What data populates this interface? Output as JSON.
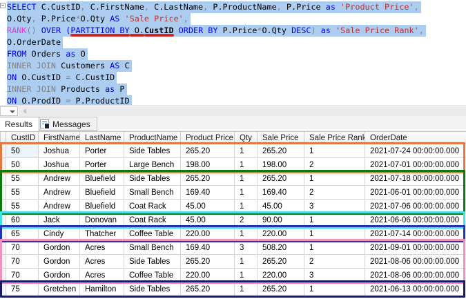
{
  "colors": {
    "sel": "#adcdf0",
    "kw": "#0000ee",
    "gray": "#838383",
    "ink": "#000000",
    "str": "#bf2e2e",
    "fn": "#dd3cdd",
    "underline": "#d32525",
    "gridline": "#d4d4d4",
    "headerline": "#c9c9c9"
  },
  "editor": {
    "lines": [
      {
        "tokens": [
          {
            "c": "k",
            "t": "SELECT"
          },
          {
            "c": "i",
            "t": " C.CustID"
          },
          {
            "c": "g",
            "t": ","
          },
          {
            "c": "i",
            "t": " C.FirstName"
          },
          {
            "c": "g",
            "t": ","
          },
          {
            "c": "i",
            "t": " C.LastName"
          },
          {
            "c": "g",
            "t": ","
          },
          {
            "c": "i",
            "t": " P.ProductName"
          },
          {
            "c": "g",
            "t": ","
          },
          {
            "c": "i",
            "t": " P.Price "
          },
          {
            "c": "k",
            "t": "as"
          },
          {
            "c": "s",
            "t": " 'Product Price'"
          },
          {
            "c": "g",
            "t": ","
          }
        ]
      },
      {
        "tokens": [
          {
            "c": "i",
            "t": "O.Qty"
          },
          {
            "c": "g",
            "t": ","
          },
          {
            "c": "i",
            "t": " P.Price"
          },
          {
            "c": "g",
            "t": "*"
          },
          {
            "c": "i",
            "t": "O.Qty "
          },
          {
            "c": "k",
            "t": "AS"
          },
          {
            "c": "s",
            "t": " 'Sale Price'"
          },
          {
            "c": "g",
            "t": ","
          }
        ]
      },
      {
        "tokens": [
          {
            "c": "f",
            "t": "RANK"
          },
          {
            "c": "g",
            "t": "()"
          },
          {
            "c": "i",
            "t": " "
          },
          {
            "c": "k",
            "t": "OVER"
          },
          {
            "c": "i",
            "t": " "
          },
          {
            "c": "k",
            "t": "("
          },
          {
            "c": "k",
            "t": "PARTITION BY",
            "u": true
          },
          {
            "c": "i",
            "t": " O.",
            "u": true
          },
          {
            "c": "b",
            "t": "CustID",
            "u": true
          },
          {
            "c": "i",
            "t": " "
          },
          {
            "c": "k",
            "t": "ORDER BY"
          },
          {
            "c": "i",
            "t": " P.Price"
          },
          {
            "c": "g",
            "t": "*"
          },
          {
            "c": "i",
            "t": "O.Qty "
          },
          {
            "c": "k",
            "t": "DESC"
          },
          {
            "c": "g",
            "t": ")"
          },
          {
            "c": "i",
            "t": " "
          },
          {
            "c": "k",
            "t": "as"
          },
          {
            "c": "s",
            "t": " 'Sale Price Rank'"
          },
          {
            "c": "g",
            "t": ","
          }
        ]
      },
      {
        "tokens": [
          {
            "c": "i",
            "t": "O.OrderDate"
          }
        ]
      },
      {
        "tokens": [
          {
            "c": "k",
            "t": "FROM"
          },
          {
            "c": "i",
            "t": " Orders "
          },
          {
            "c": "k",
            "t": "as"
          },
          {
            "c": "i",
            "t": " O"
          }
        ]
      },
      {
        "tokens": [
          {
            "c": "g",
            "t": "INNER JOIN"
          },
          {
            "c": "i",
            "t": " Customers "
          },
          {
            "c": "k",
            "t": "AS"
          },
          {
            "c": "i",
            "t": " C"
          }
        ]
      },
      {
        "tokens": [
          {
            "c": "k",
            "t": "ON"
          },
          {
            "c": "i",
            "t": " O.CustID "
          },
          {
            "c": "g",
            "t": "="
          },
          {
            "c": "i",
            "t": " C.CustID"
          }
        ]
      },
      {
        "tokens": [
          {
            "c": "g",
            "t": "INNER JOIN"
          },
          {
            "c": "i",
            "t": " Products "
          },
          {
            "c": "k",
            "t": "as"
          },
          {
            "c": "i",
            "t": " P"
          }
        ]
      },
      {
        "tokens": [
          {
            "c": "k",
            "t": "ON"
          },
          {
            "c": "i",
            "t": " O.ProdID "
          },
          {
            "c": "g",
            "t": "="
          },
          {
            "c": "i",
            "t": " P.ProductID"
          }
        ]
      }
    ]
  },
  "tabs": {
    "results": "Results",
    "messages": "Messages"
  },
  "results": {
    "columns": [
      "CustID",
      "FirstName",
      "LastName",
      "ProductName",
      "Product Price",
      "Qty",
      "Sale Price",
      "Sale Price Rank",
      "OrderDate"
    ],
    "rows": [
      [
        "50",
        "Joshua",
        "Porter",
        "Side Tables",
        "265.20",
        "1",
        "265.20",
        "1",
        "2021-07-24 00:00:00.000"
      ],
      [
        "50",
        "Joshua",
        "Porter",
        "Large Bench",
        "198.00",
        "1",
        "198.00",
        "2",
        "2021-07-01 00:00:00.000"
      ],
      [
        "55",
        "Andrew",
        "Bluefield",
        "Side Tables",
        "265.20",
        "1",
        "265.20",
        "1",
        "2021-07-18 00:00:00.000"
      ],
      [
        "55",
        "Andrew",
        "Bluefield",
        "Small Bench",
        "169.40",
        "1",
        "169.40",
        "2",
        "2021-06-01 00:00:00.000"
      ],
      [
        "55",
        "Andrew",
        "Bluefield",
        "Coat Rack",
        "45.00",
        "1",
        "45.00",
        "3",
        "2021-07-06 00:00:00.000"
      ],
      [
        "60",
        "Jack",
        "Donovan",
        "Coat Rack",
        "45.00",
        "2",
        "90.00",
        "1",
        "2021-06-06 00:00:00.000"
      ],
      [
        "65",
        "Cindy",
        "Thatcher",
        "Coffee Table",
        "220.00",
        "1",
        "220.00",
        "1",
        "2021-07-14 00:00:00.000"
      ],
      [
        "70",
        "Gordon",
        "Acres",
        "Small Bench",
        "169.40",
        "3",
        "508.20",
        "1",
        "2021-09-01 00:00:00.000"
      ],
      [
        "70",
        "Gordon",
        "Acres",
        "Side Tables",
        "265.20",
        "1",
        "265.20",
        "2",
        "2021-08-06 00:00:00.000"
      ],
      [
        "70",
        "Gordon",
        "Acres",
        "Coffee Table",
        "220.00",
        "1",
        "220.00",
        "3",
        "2021-08-06 00:00:00.000"
      ],
      [
        "75",
        "Gretchen",
        "Hamilton",
        "Side Tables",
        "265.20",
        "1",
        "265.20",
        "1",
        "2021-06-13 00:00:00.000"
      ]
    ]
  },
  "annotations": [
    {
      "name": "custid-50-group",
      "rows": [
        0,
        1
      ],
      "color": "#e2793e"
    },
    {
      "name": "custid-55-group",
      "rows": [
        2,
        4
      ],
      "color": "#0e770e"
    },
    {
      "name": "custid-60-group",
      "rows": [
        5,
        5
      ],
      "color": "#3ee3e3"
    },
    {
      "name": "custid-65-group",
      "rows": [
        6,
        6
      ],
      "color": "#2233b4"
    },
    {
      "name": "custid-70-group",
      "rows": [
        7,
        9
      ],
      "color": "#ef92c0"
    },
    {
      "name": "custid-75-group",
      "rows": [
        10,
        10
      ],
      "color": "#1a1a60"
    }
  ]
}
